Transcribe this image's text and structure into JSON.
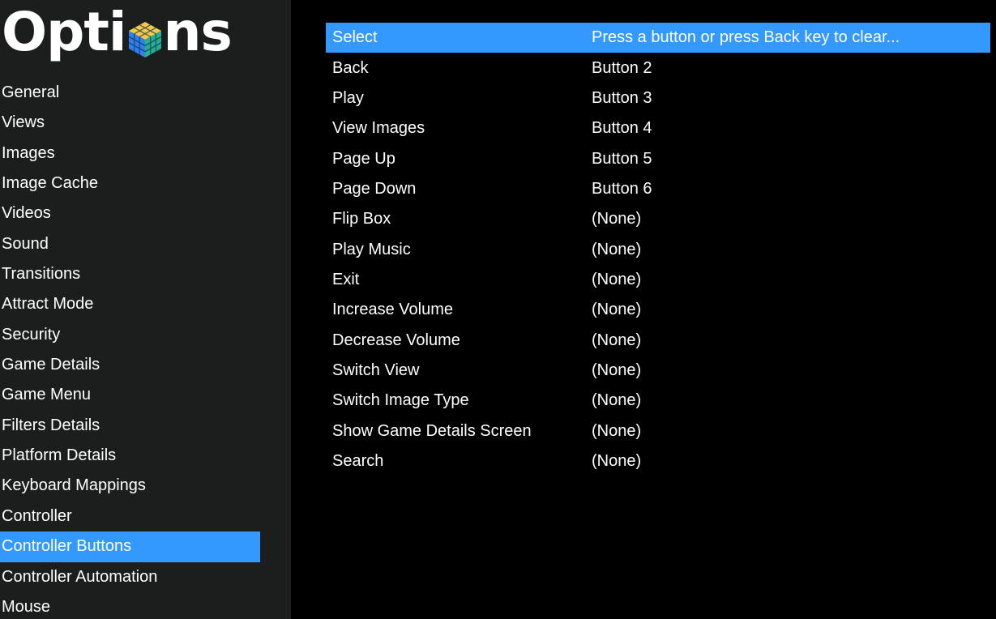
{
  "colors": {
    "accent": "#3399ff",
    "sidebar_bg": "#1b1e1d",
    "main_bg": "#000000"
  },
  "header": {
    "title_left": "Opti",
    "title_icon": "cube-icon",
    "title_right": "ns"
  },
  "sidebar": {
    "selected_index": 15,
    "items": [
      {
        "label": "General"
      },
      {
        "label": "Views"
      },
      {
        "label": "Images"
      },
      {
        "label": "Image Cache"
      },
      {
        "label": "Videos"
      },
      {
        "label": "Sound"
      },
      {
        "label": "Transitions"
      },
      {
        "label": "Attract Mode"
      },
      {
        "label": "Security"
      },
      {
        "label": "Game Details"
      },
      {
        "label": "Game Menu"
      },
      {
        "label": "Filters Details"
      },
      {
        "label": "Platform Details"
      },
      {
        "label": "Keyboard Mappings"
      },
      {
        "label": "Controller"
      },
      {
        "label": "Controller Buttons"
      },
      {
        "label": "Controller Automation"
      },
      {
        "label": "Mouse"
      }
    ]
  },
  "mappings": {
    "selected_index": 0,
    "rows": [
      {
        "action": "Select",
        "binding": "Press a button or press Back key to clear..."
      },
      {
        "action": "Back",
        "binding": "Button 2"
      },
      {
        "action": "Play",
        "binding": "Button 3"
      },
      {
        "action": "View Images",
        "binding": "Button 4"
      },
      {
        "action": "Page Up",
        "binding": "Button 5"
      },
      {
        "action": "Page Down",
        "binding": "Button 6"
      },
      {
        "action": "Flip Box",
        "binding": "(None)"
      },
      {
        "action": "Play Music",
        "binding": "(None)"
      },
      {
        "action": "Exit",
        "binding": "(None)"
      },
      {
        "action": "Increase Volume",
        "binding": "(None)"
      },
      {
        "action": "Decrease Volume",
        "binding": "(None)"
      },
      {
        "action": "Switch View",
        "binding": "(None)"
      },
      {
        "action": "Switch Image Type",
        "binding": "(None)"
      },
      {
        "action": "Show Game Details Screen",
        "binding": "(None)"
      },
      {
        "action": "Search",
        "binding": "(None)"
      }
    ]
  }
}
